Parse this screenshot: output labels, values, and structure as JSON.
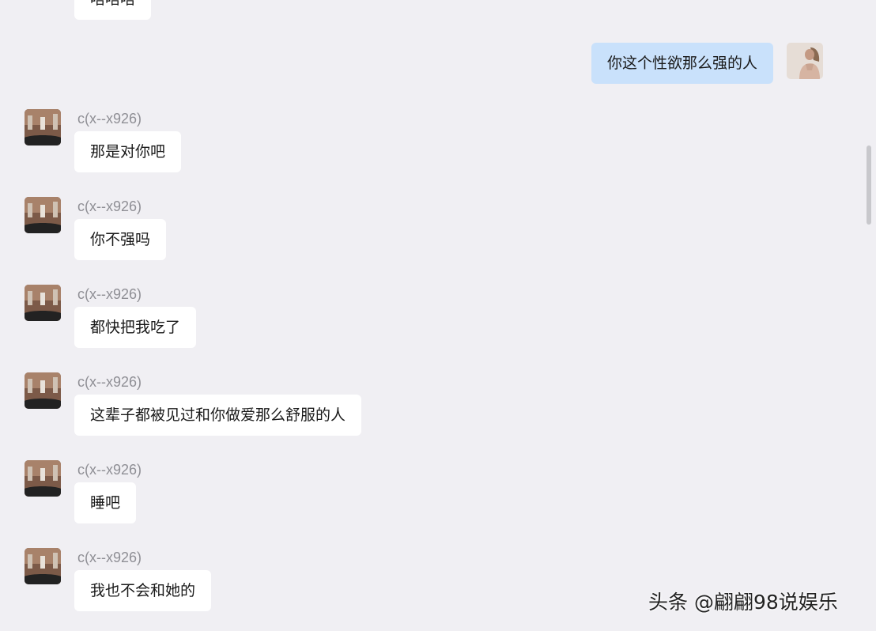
{
  "partial_top_message": {
    "text": "唔唔唔"
  },
  "outgoing_message": {
    "text": "你这个性欲那么强的人"
  },
  "incoming_messages": [
    {
      "sender": "c(x--x926)",
      "text": "那是对你吧"
    },
    {
      "sender": "c(x--x926)",
      "text": "你不强吗"
    },
    {
      "sender": "c(x--x926)",
      "text": "都快把我吃了"
    },
    {
      "sender": "c(x--x926)",
      "text": "这辈子都被见过和你做爱那么舒服的人"
    },
    {
      "sender": "c(x--x926)",
      "text": "睡吧"
    },
    {
      "sender": "c(x--x926)",
      "text": "我也不会和她的"
    }
  ],
  "watermark": {
    "text": "头条 @翩翩98说娱乐"
  },
  "colors": {
    "background": "#f0eff3",
    "incoming_bubble": "#ffffff",
    "outgoing_bubble": "#c9e1fb",
    "sender_name": "#8f8f95"
  }
}
